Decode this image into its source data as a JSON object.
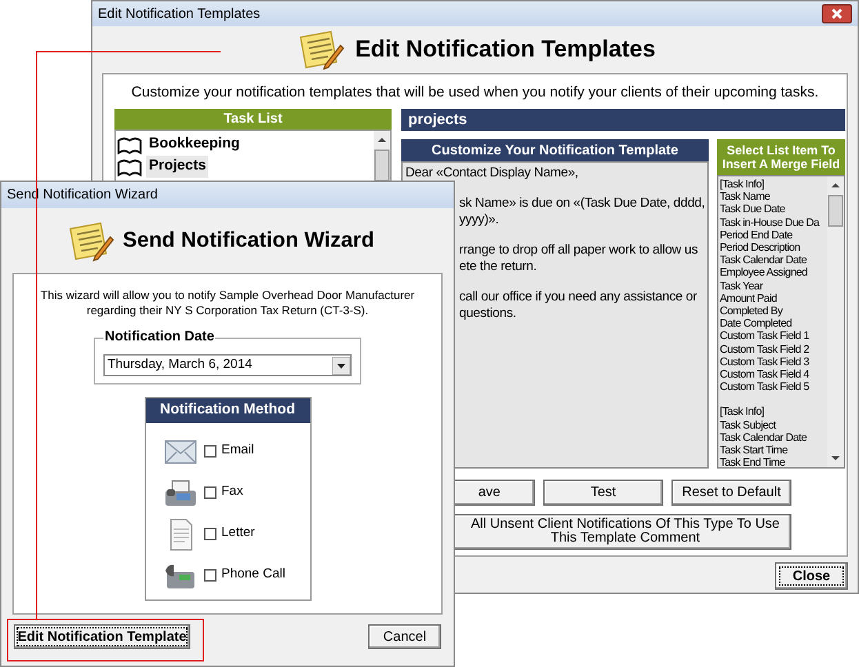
{
  "edit_window": {
    "title": "Edit Notification Templates",
    "heading": "Edit Notification Templates",
    "description": "Customize your notification templates that will be used when you notify your clients of their upcoming tasks.",
    "task_list": {
      "header": "Task List",
      "items": [
        {
          "label": "Bookkeeping",
          "selected": false
        },
        {
          "label": "Projects",
          "selected": true
        }
      ]
    },
    "category": "projects",
    "template": {
      "header": "Customize Your Notification Template",
      "paragraphs": [
        [
          "Dear «Contact Display Name»,"
        ],
        [
          "sk Name» is due on «(Task Due Date, dddd,",
          "yyyy)»."
        ],
        [
          "rrange to drop off all paper work to allow us",
          "ete the return."
        ],
        [
          "call our office if you need any assistance or",
          "questions."
        ]
      ]
    },
    "merge_fields": {
      "header": "Select List Item To Insert A Merge Field",
      "groups": [
        [
          "[Task Info]",
          "Task Name",
          "Task Due Date",
          "Task in-House Due Da",
          "Period End Date",
          "Period Description",
          "Task Calendar Date",
          "Employee Assigned",
          "Task Year",
          "Amount Paid",
          "Completed By",
          "Date Completed",
          "Custom Task Field 1",
          "Custom Task Field 2",
          "Custom Task Field 3",
          "Custom Task Field 4",
          "Custom Task Field 5"
        ],
        [
          "[Task Info]",
          "Task Subject",
          "Task Calendar Date",
          "Task Start Time",
          "Task End Time"
        ]
      ]
    },
    "buttons": [
      "ave",
      "Test",
      "Reset to Default"
    ],
    "update_button": "All Unsent Client Notifications Of This Type To Use This Template Comment",
    "close_button": "Close"
  },
  "wizard": {
    "title": "Send Notification Wizard",
    "heading": "Send Notification Wizard",
    "description": "This wizard will allow you to notify Sample Overhead Door Manufacturer regarding their NY S Corporation Tax Return (CT-3-S).",
    "date_group": {
      "label": "Notification Date",
      "value": "Thursday, March 6, 2014"
    },
    "method": {
      "header": "Notification Method",
      "options": [
        {
          "label": "Email",
          "checked": false
        },
        {
          "label": "Fax",
          "checked": false
        },
        {
          "label": "Letter",
          "checked": false
        },
        {
          "label": "Phone Call",
          "checked": false
        }
      ]
    },
    "buttons": [
      "Edit Notification Template",
      "Cancel"
    ]
  }
}
